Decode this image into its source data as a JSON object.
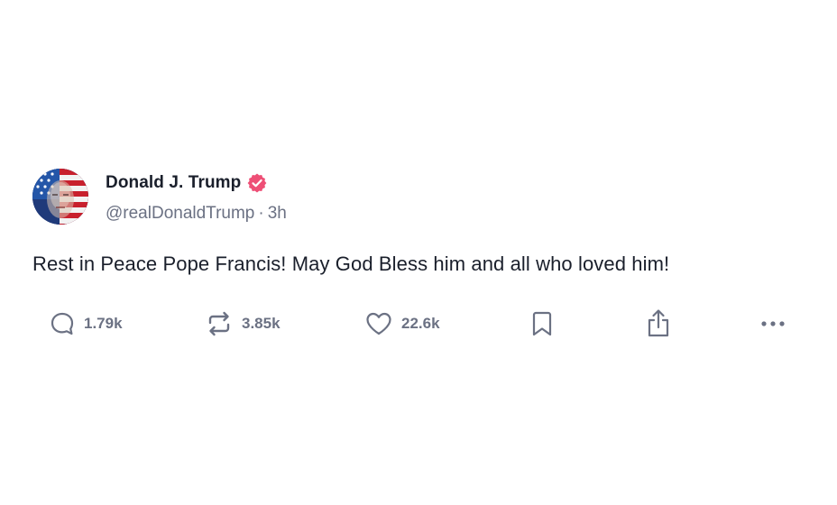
{
  "post": {
    "author": {
      "display_name": "Donald J. Trump",
      "handle": "@realDonaldTrump",
      "verified": true,
      "avatar_icon": "flag-portrait-avatar"
    },
    "separator": "·",
    "time_ago": "3h",
    "text": "Rest in Peace Pope Francis! May God Bless him and all who loved him!",
    "actions": {
      "replies": "1.79k",
      "reposts": "3.85k",
      "likes": "22.6k",
      "bookmark_icon": "bookmark-icon",
      "share_icon": "share-icon",
      "more_icon": "more-icon"
    }
  },
  "colors": {
    "text_primary": "#1a1f2b",
    "text_secondary": "#6b7183",
    "verified_badge": "#ee4f76"
  }
}
